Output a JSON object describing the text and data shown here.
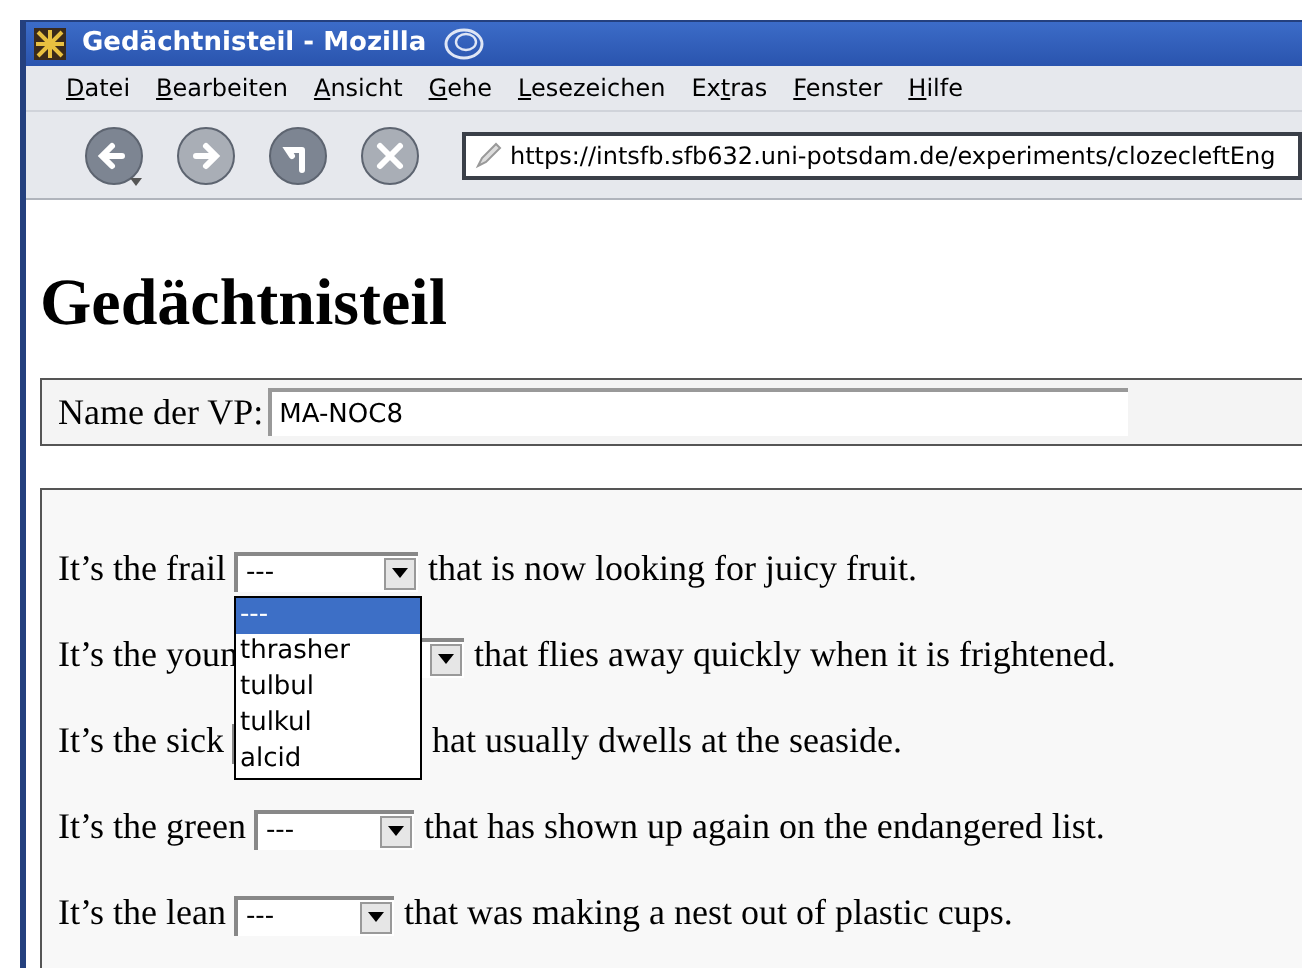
{
  "window": {
    "title": "Gedächtnisteil - Mozilla"
  },
  "menu": [
    {
      "key": "D",
      "post": "atei"
    },
    {
      "key": "B",
      "post": "earbeiten"
    },
    {
      "key": "A",
      "post": "nsicht"
    },
    {
      "key": "G",
      "post": "ehe"
    },
    {
      "key": "L",
      "post": "esezeichen"
    },
    {
      "pre": "Ex",
      "key": "t",
      "post": "ras"
    },
    {
      "key": "F",
      "post": "enster"
    },
    {
      "key": "H",
      "post": "ilfe"
    }
  ],
  "toolbar": [
    {
      "kind": "back",
      "disabled": false
    },
    {
      "kind": "forward",
      "disabled": true
    },
    {
      "kind": "reload",
      "disabled": false
    },
    {
      "kind": "stop",
      "disabled": true
    }
  ],
  "address": "https://intsfb.sfb632.uni-potsdam.de/experiments/clozecleftEng",
  "heading": "Gedächtnisteil",
  "name_field": {
    "label": "Name der VP:",
    "value": "MA-NOC8"
  },
  "sentences": [
    {
      "before": "It’s the frail",
      "value": "---",
      "after": "that is now looking for juicy fruit.",
      "options": [
        {
          "label": "---",
          "selected": true
        },
        {
          "label": "thrasher",
          "selected": false
        },
        {
          "label": "tulbul",
          "selected": false
        },
        {
          "label": "tulkul",
          "selected": false
        },
        {
          "label": "alcid",
          "selected": false
        }
      ]
    },
    {
      "before": "It’s the youn",
      "after": "that flies away quickly when it is frightened."
    },
    {
      "before": "It’s the sick",
      "after": "hat usually dwells at the seaside."
    },
    {
      "before": "It’s the green",
      "value": "---",
      "after": "that has shown up again on the endangered list."
    },
    {
      "before": "It’s the lean",
      "value": "---",
      "after": "that was making a nest out of plastic cups."
    }
  ]
}
